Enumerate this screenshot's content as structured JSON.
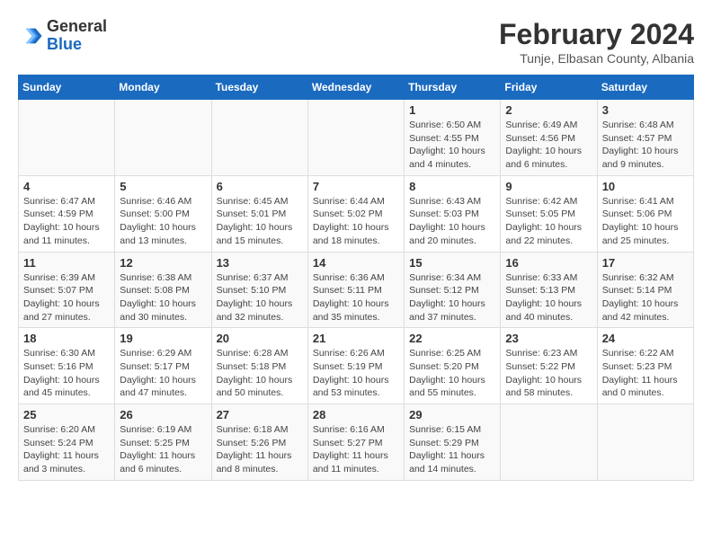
{
  "header": {
    "logo_general": "General",
    "logo_blue": "Blue",
    "month_year": "February 2024",
    "location": "Tunje, Elbasan County, Albania"
  },
  "weekdays": [
    "Sunday",
    "Monday",
    "Tuesday",
    "Wednesday",
    "Thursday",
    "Friday",
    "Saturday"
  ],
  "weeks": [
    [
      {
        "day": "",
        "info": ""
      },
      {
        "day": "",
        "info": ""
      },
      {
        "day": "",
        "info": ""
      },
      {
        "day": "",
        "info": ""
      },
      {
        "day": "1",
        "info": "Sunrise: 6:50 AM\nSunset: 4:55 PM\nDaylight: 10 hours\nand 4 minutes."
      },
      {
        "day": "2",
        "info": "Sunrise: 6:49 AM\nSunset: 4:56 PM\nDaylight: 10 hours\nand 6 minutes."
      },
      {
        "day": "3",
        "info": "Sunrise: 6:48 AM\nSunset: 4:57 PM\nDaylight: 10 hours\nand 9 minutes."
      }
    ],
    [
      {
        "day": "4",
        "info": "Sunrise: 6:47 AM\nSunset: 4:59 PM\nDaylight: 10 hours\nand 11 minutes."
      },
      {
        "day": "5",
        "info": "Sunrise: 6:46 AM\nSunset: 5:00 PM\nDaylight: 10 hours\nand 13 minutes."
      },
      {
        "day": "6",
        "info": "Sunrise: 6:45 AM\nSunset: 5:01 PM\nDaylight: 10 hours\nand 15 minutes."
      },
      {
        "day": "7",
        "info": "Sunrise: 6:44 AM\nSunset: 5:02 PM\nDaylight: 10 hours\nand 18 minutes."
      },
      {
        "day": "8",
        "info": "Sunrise: 6:43 AM\nSunset: 5:03 PM\nDaylight: 10 hours\nand 20 minutes."
      },
      {
        "day": "9",
        "info": "Sunrise: 6:42 AM\nSunset: 5:05 PM\nDaylight: 10 hours\nand 22 minutes."
      },
      {
        "day": "10",
        "info": "Sunrise: 6:41 AM\nSunset: 5:06 PM\nDaylight: 10 hours\nand 25 minutes."
      }
    ],
    [
      {
        "day": "11",
        "info": "Sunrise: 6:39 AM\nSunset: 5:07 PM\nDaylight: 10 hours\nand 27 minutes."
      },
      {
        "day": "12",
        "info": "Sunrise: 6:38 AM\nSunset: 5:08 PM\nDaylight: 10 hours\nand 30 minutes."
      },
      {
        "day": "13",
        "info": "Sunrise: 6:37 AM\nSunset: 5:10 PM\nDaylight: 10 hours\nand 32 minutes."
      },
      {
        "day": "14",
        "info": "Sunrise: 6:36 AM\nSunset: 5:11 PM\nDaylight: 10 hours\nand 35 minutes."
      },
      {
        "day": "15",
        "info": "Sunrise: 6:34 AM\nSunset: 5:12 PM\nDaylight: 10 hours\nand 37 minutes."
      },
      {
        "day": "16",
        "info": "Sunrise: 6:33 AM\nSunset: 5:13 PM\nDaylight: 10 hours\nand 40 minutes."
      },
      {
        "day": "17",
        "info": "Sunrise: 6:32 AM\nSunset: 5:14 PM\nDaylight: 10 hours\nand 42 minutes."
      }
    ],
    [
      {
        "day": "18",
        "info": "Sunrise: 6:30 AM\nSunset: 5:16 PM\nDaylight: 10 hours\nand 45 minutes."
      },
      {
        "day": "19",
        "info": "Sunrise: 6:29 AM\nSunset: 5:17 PM\nDaylight: 10 hours\nand 47 minutes."
      },
      {
        "day": "20",
        "info": "Sunrise: 6:28 AM\nSunset: 5:18 PM\nDaylight: 10 hours\nand 50 minutes."
      },
      {
        "day": "21",
        "info": "Sunrise: 6:26 AM\nSunset: 5:19 PM\nDaylight: 10 hours\nand 53 minutes."
      },
      {
        "day": "22",
        "info": "Sunrise: 6:25 AM\nSunset: 5:20 PM\nDaylight: 10 hours\nand 55 minutes."
      },
      {
        "day": "23",
        "info": "Sunrise: 6:23 AM\nSunset: 5:22 PM\nDaylight: 10 hours\nand 58 minutes."
      },
      {
        "day": "24",
        "info": "Sunrise: 6:22 AM\nSunset: 5:23 PM\nDaylight: 11 hours\nand 0 minutes."
      }
    ],
    [
      {
        "day": "25",
        "info": "Sunrise: 6:20 AM\nSunset: 5:24 PM\nDaylight: 11 hours\nand 3 minutes."
      },
      {
        "day": "26",
        "info": "Sunrise: 6:19 AM\nSunset: 5:25 PM\nDaylight: 11 hours\nand 6 minutes."
      },
      {
        "day": "27",
        "info": "Sunrise: 6:18 AM\nSunset: 5:26 PM\nDaylight: 11 hours\nand 8 minutes."
      },
      {
        "day": "28",
        "info": "Sunrise: 6:16 AM\nSunset: 5:27 PM\nDaylight: 11 hours\nand 11 minutes."
      },
      {
        "day": "29",
        "info": "Sunrise: 6:15 AM\nSunset: 5:29 PM\nDaylight: 11 hours\nand 14 minutes."
      },
      {
        "day": "",
        "info": ""
      },
      {
        "day": "",
        "info": ""
      }
    ]
  ]
}
